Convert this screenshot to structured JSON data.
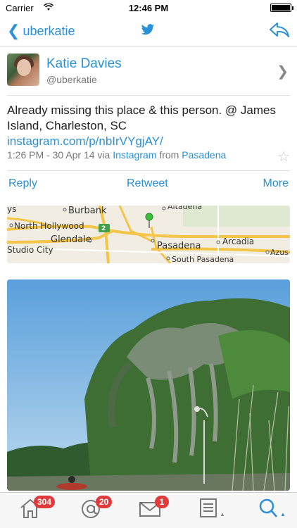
{
  "status_bar": {
    "carrier": "Carrier",
    "time": "12:46 PM"
  },
  "nav": {
    "back_label": "uberkatie"
  },
  "profile": {
    "name": "Katie Davies",
    "handle": "@uberkatie"
  },
  "tweet": {
    "text": "Already missing this place & this person. @ James Island, Charleston, SC",
    "link": "instagram.com/p/nbIrVYgjAY/",
    "timestamp": "1:26 PM - 30 Apr 14 via",
    "via_app": "Instagram",
    "from_word": "from",
    "location": "Pasadena"
  },
  "actions": {
    "reply": "Reply",
    "retweet": "Retweet",
    "more": "More"
  },
  "map": {
    "labels": {
      "ys": "ys",
      "burbank": "Burbank",
      "altadena": "Altadena",
      "north_hollywood": "North Hollywood",
      "glendale": "Glendale",
      "route": "2",
      "pasadena": "Pasadena",
      "arcadia": "Arcadia",
      "studio_city": "Studio City",
      "south_pasadena": "South Pasadena",
      "azusa": "Azus"
    }
  },
  "tab_bar": {
    "home_badge": "304",
    "mentions_badge": "20",
    "messages_badge": "1"
  },
  "colors": {
    "accent": "#2a90d8",
    "badge": "#e03a3a"
  }
}
